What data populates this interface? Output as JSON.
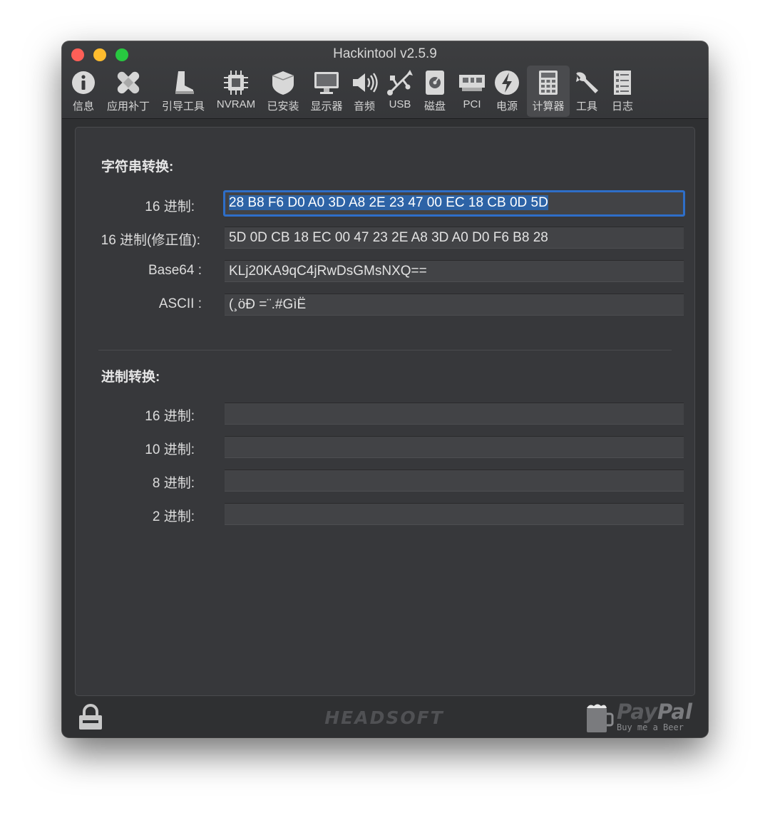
{
  "window": {
    "title": "Hackintool v2.5.9"
  },
  "toolbar": {
    "items": [
      {
        "label": "信息",
        "icon": "info-icon"
      },
      {
        "label": "应用补丁",
        "icon": "bandage-icon"
      },
      {
        "label": "引导工具",
        "icon": "boot-icon"
      },
      {
        "label": "NVRAM",
        "icon": "chip-icon"
      },
      {
        "label": "已安装",
        "icon": "installed-icon"
      },
      {
        "label": "显示器",
        "icon": "monitor-icon"
      },
      {
        "label": "音频",
        "icon": "speaker-icon"
      },
      {
        "label": "USB",
        "icon": "usb-icon"
      },
      {
        "label": "磁盘",
        "icon": "disk-icon"
      },
      {
        "label": "PCI",
        "icon": "pci-card-icon"
      },
      {
        "label": "电源",
        "icon": "power-icon"
      },
      {
        "label": "计算器",
        "icon": "calculator-icon",
        "active": true
      },
      {
        "label": "工具",
        "icon": "wrench-icon"
      },
      {
        "label": "日志",
        "icon": "log-icon"
      }
    ]
  },
  "string_conversion": {
    "title": "字符串转换:",
    "hex_label": "16 进制:",
    "hex_value": "28 B8 F6 D0 A0 3D A8 2E 23 47 00 EC 18 CB 0D 5D",
    "hex_fixed_label": "16 进制(修正值):",
    "hex_fixed_value": "5D 0D CB 18 EC 00 47 23 2E A8 3D A0 D0 F6 B8 28",
    "base64_label": "Base64 :",
    "base64_value": "KLj20KA9qC4jRwDsGMsNXQ==",
    "ascii_label": "ASCII :",
    "ascii_value": "(¸öÐ =¨.#GìË"
  },
  "base_conversion": {
    "title": "进制转换:",
    "hex_label": "16 进制:",
    "hex_value": "",
    "dec_label": "10 进制:",
    "dec_value": "",
    "oct_label": "8 进制:",
    "oct_value": "",
    "bin_label": "2 进制:",
    "bin_value": ""
  },
  "footer": {
    "brand": "HEADSOFT",
    "paypal_pay": "Pay",
    "paypal_pal": "Pal",
    "paypal_sub": "Buy me a Beer"
  },
  "colors": {
    "accent": "#2e6ec8",
    "selection": "#2d63a6",
    "close": "#fe5f57",
    "minimize": "#febc2e",
    "maximize": "#28c840"
  }
}
